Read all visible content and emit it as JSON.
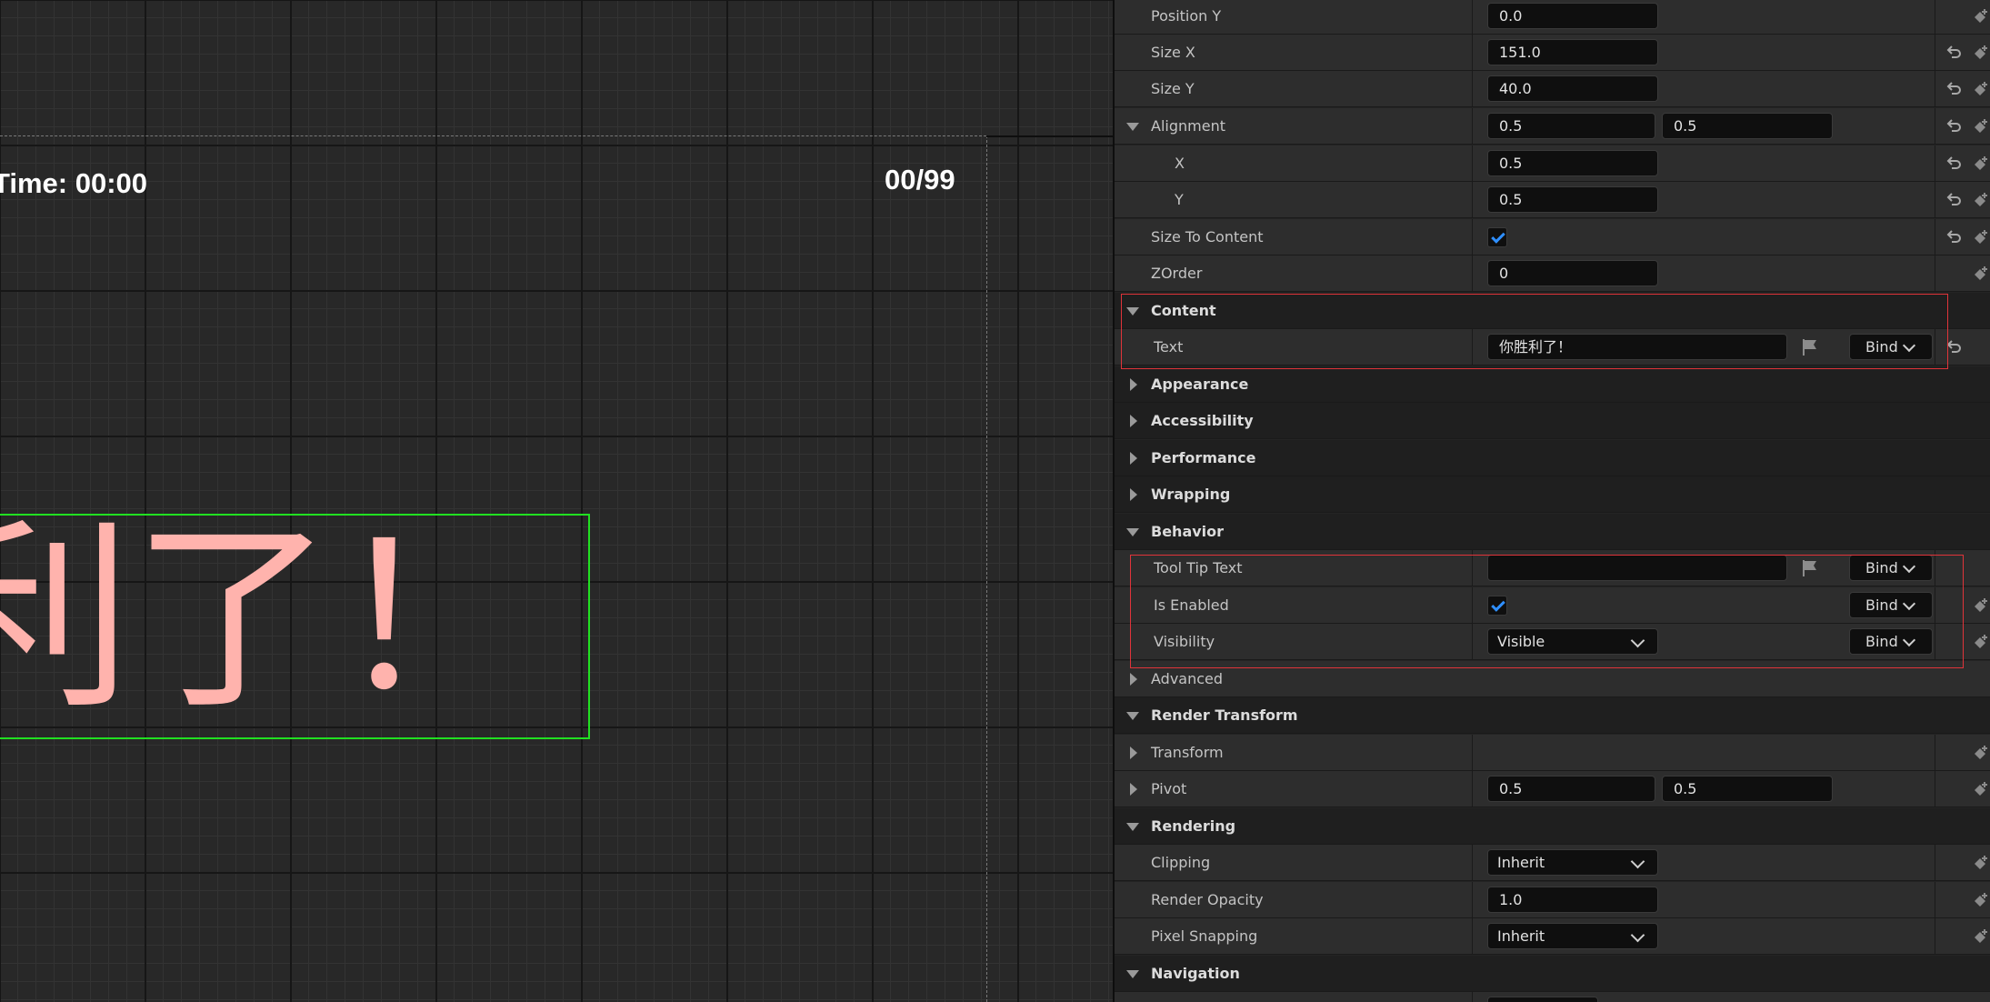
{
  "viewport": {
    "time_text": "Time: 00:00",
    "counter_text": "00/99",
    "win_text": "利了！"
  },
  "details": {
    "position_y": {
      "label": "Position Y",
      "value": "0.0"
    },
    "size_x": {
      "label": "Size X",
      "value": "151.0"
    },
    "size_y": {
      "label": "Size Y",
      "value": "40.0"
    },
    "alignment": {
      "label": "Alignment",
      "x": "0.5",
      "y": "0.5"
    },
    "alignment_x": {
      "label": "X",
      "value": "0.5"
    },
    "alignment_y": {
      "label": "Y",
      "value": "0.5"
    },
    "size_to_content": {
      "label": "Size To Content",
      "checked": true
    },
    "zorder": {
      "label": "ZOrder",
      "value": "0"
    },
    "content": {
      "label": "Content"
    },
    "text": {
      "label": "Text",
      "value": "你胜利了！",
      "bind_label": "Bind"
    },
    "appearance": {
      "label": "Appearance"
    },
    "accessibility": {
      "label": "Accessibility"
    },
    "performance": {
      "label": "Performance"
    },
    "wrapping": {
      "label": "Wrapping"
    },
    "behavior": {
      "label": "Behavior"
    },
    "tool_tip_text": {
      "label": "Tool Tip Text",
      "value": "",
      "bind_label": "Bind"
    },
    "is_enabled": {
      "label": "Is Enabled",
      "checked": true,
      "bind_label": "Bind"
    },
    "visibility": {
      "label": "Visibility",
      "value": "Visible",
      "bind_label": "Bind"
    },
    "advanced": {
      "label": "Advanced"
    },
    "render_transform": {
      "label": "Render Transform"
    },
    "transform": {
      "label": "Transform"
    },
    "pivot": {
      "label": "Pivot",
      "x": "0.5",
      "y": "0.5"
    },
    "rendering": {
      "label": "Rendering"
    },
    "clipping": {
      "label": "Clipping",
      "value": "Inherit"
    },
    "render_opacity": {
      "label": "Render Opacity",
      "value": "1.0"
    },
    "pixel_snapping": {
      "label": "Pixel Snapping",
      "value": "Inherit"
    },
    "navigation": {
      "label": "Navigation"
    }
  },
  "colors": {
    "highlight_border": "#e0343a",
    "widget_outline": "#21e021",
    "win_text_color": "#ffb3ad",
    "checkbox_check": "#2f8fff"
  },
  "icons": {
    "reset": "reset-to-default-icon",
    "keyframe": "add-keyframe-icon",
    "flag": "localization-flag-icon"
  }
}
